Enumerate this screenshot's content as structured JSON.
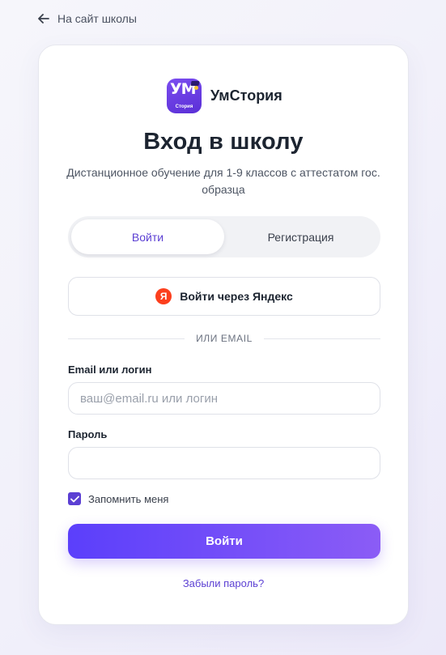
{
  "nav": {
    "back_label": "На сайт школы"
  },
  "brand": {
    "logo_monogram": "УМ",
    "logo_subtext": "Стория",
    "name": "УмСтория"
  },
  "header": {
    "title": "Вход в школу",
    "subtitle": "Дистанционное обучение для 1-9 классов с аттестатом гос. образца"
  },
  "tabs": [
    {
      "label": "Войти",
      "active": true
    },
    {
      "label": "Регистрация",
      "active": false
    }
  ],
  "oauth": {
    "yandex_icon_letter": "Я",
    "yandex_label": "Войти через Яндекс"
  },
  "divider": {
    "text": "ИЛИ EMAIL"
  },
  "form": {
    "email_label": "Email или логин",
    "email_value": "",
    "email_placeholder": "ваш@email.ru или логин",
    "password_label": "Пароль",
    "password_value": "",
    "remember_label": "Запомнить меня",
    "remember_checked": true,
    "submit_label": "Войти",
    "forgot_label": "Забыли пароль?"
  },
  "colors": {
    "accent": "#5b3fd3",
    "button_gradient_start": "#5b3ffb",
    "button_gradient_end": "#8b5cf6",
    "yandex_red": "#fc3f1d"
  }
}
